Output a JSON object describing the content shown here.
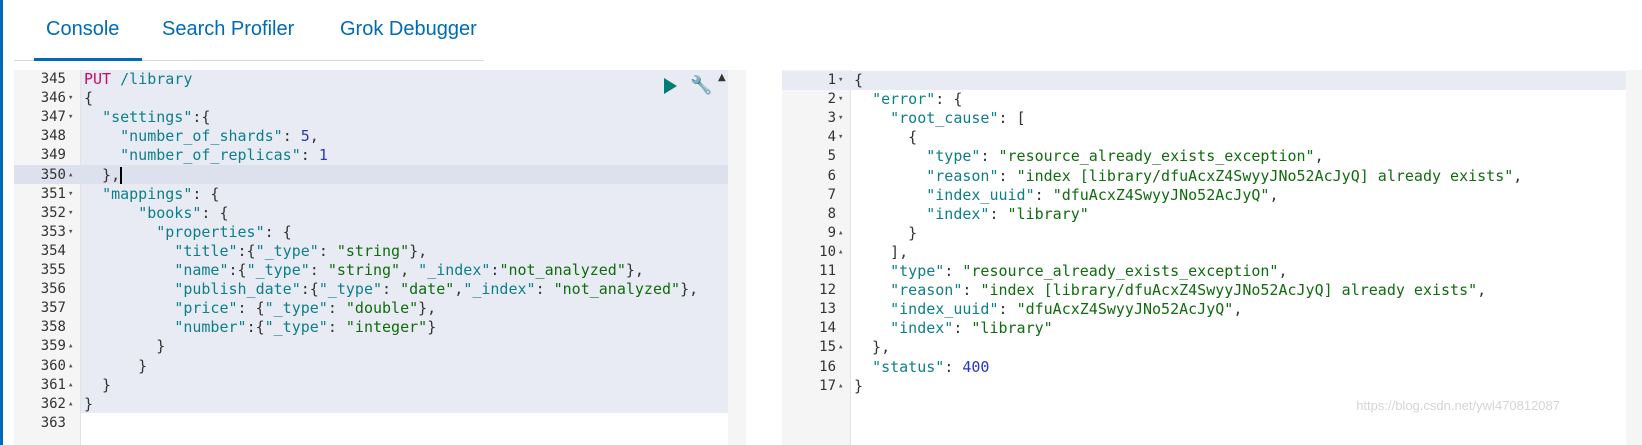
{
  "tabs": [
    "Console",
    "Search Profiler",
    "Grok Debugger"
  ],
  "request": {
    "lines": [
      {
        "n": "345",
        "f": "",
        "t": [
          [
            "m",
            "PUT"
          ],
          [
            "p",
            " "
          ],
          [
            "u",
            "/library"
          ]
        ]
      },
      {
        "n": "346",
        "f": "▾",
        "t": [
          [
            "p",
            "{"
          ]
        ]
      },
      {
        "n": "347",
        "f": "▾",
        "t": [
          [
            "p",
            "  "
          ],
          [
            "k",
            "\"settings\""
          ],
          [
            "p",
            ":{"
          ]
        ]
      },
      {
        "n": "348",
        "f": "",
        "t": [
          [
            "p",
            "    "
          ],
          [
            "k",
            "\"number_of_shards\""
          ],
          [
            "p",
            ": "
          ],
          [
            "n",
            "5"
          ],
          [
            "p",
            ","
          ]
        ]
      },
      {
        "n": "349",
        "f": "",
        "t": [
          [
            "p",
            "    "
          ],
          [
            "k",
            "\"number_of_replicas\""
          ],
          [
            "p",
            ": "
          ],
          [
            "n",
            "1"
          ]
        ]
      },
      {
        "n": "350",
        "f": "▴",
        "t": [
          [
            "p",
            "  },"
          ]
        ],
        "cursor": true
      },
      {
        "n": "351",
        "f": "▾",
        "t": [
          [
            "p",
            "  "
          ],
          [
            "k",
            "\"mappings\""
          ],
          [
            "p",
            ": {"
          ]
        ]
      },
      {
        "n": "352",
        "f": "▾",
        "t": [
          [
            "p",
            "      "
          ],
          [
            "k",
            "\"books\""
          ],
          [
            "p",
            ": {"
          ]
        ]
      },
      {
        "n": "353",
        "f": "▾",
        "t": [
          [
            "p",
            "        "
          ],
          [
            "k",
            "\"properties\""
          ],
          [
            "p",
            ": {"
          ]
        ]
      },
      {
        "n": "354",
        "f": "",
        "t": [
          [
            "p",
            "          "
          ],
          [
            "k",
            "\"title\""
          ],
          [
            "p",
            ":{"
          ],
          [
            "k",
            "\"_type\""
          ],
          [
            "p",
            ": "
          ],
          [
            "s",
            "\"string\""
          ],
          [
            "p",
            "},"
          ]
        ]
      },
      {
        "n": "355",
        "f": "",
        "t": [
          [
            "p",
            "          "
          ],
          [
            "k",
            "\"name\""
          ],
          [
            "p",
            ":{"
          ],
          [
            "k",
            "\"_type\""
          ],
          [
            "p",
            ": "
          ],
          [
            "s",
            "\"string\""
          ],
          [
            "p",
            ", "
          ],
          [
            "k",
            "\"_index\""
          ],
          [
            "p",
            ":"
          ],
          [
            "s",
            "\"not_analyzed\""
          ],
          [
            "p",
            "},"
          ]
        ]
      },
      {
        "n": "356",
        "f": "",
        "t": [
          [
            "p",
            "          "
          ],
          [
            "k",
            "\"publish_date\""
          ],
          [
            "p",
            ":{"
          ],
          [
            "k",
            "\"_type\""
          ],
          [
            "p",
            ": "
          ],
          [
            "s",
            "\"date\""
          ],
          [
            "p",
            ","
          ],
          [
            "k",
            "\"_index\""
          ],
          [
            "p",
            ": "
          ],
          [
            "s",
            "\"not_analyzed\""
          ],
          [
            "p",
            "},"
          ]
        ]
      },
      {
        "n": "357",
        "f": "",
        "t": [
          [
            "p",
            "          "
          ],
          [
            "k",
            "\"price\""
          ],
          [
            "p",
            ": {"
          ],
          [
            "k",
            "\"_type\""
          ],
          [
            "p",
            ": "
          ],
          [
            "s",
            "\"double\""
          ],
          [
            "p",
            "},"
          ]
        ]
      },
      {
        "n": "358",
        "f": "",
        "t": [
          [
            "p",
            "          "
          ],
          [
            "k",
            "\"number\""
          ],
          [
            "p",
            ":{"
          ],
          [
            "k",
            "\"_type\""
          ],
          [
            "p",
            ": "
          ],
          [
            "s",
            "\"integer\""
          ],
          [
            "p",
            "}"
          ]
        ]
      },
      {
        "n": "359",
        "f": "▴",
        "t": [
          [
            "p",
            "        }"
          ]
        ]
      },
      {
        "n": "360",
        "f": "▴",
        "t": [
          [
            "p",
            "      }"
          ]
        ]
      },
      {
        "n": "361",
        "f": "▴",
        "t": [
          [
            "p",
            "  }"
          ]
        ]
      },
      {
        "n": "362",
        "f": "▴",
        "t": [
          [
            "p",
            "}"
          ]
        ]
      },
      {
        "n": "363",
        "f": "",
        "t": []
      }
    ]
  },
  "response": {
    "lines": [
      {
        "n": "1",
        "f": "▾",
        "t": [
          [
            "p",
            "{"
          ]
        ]
      },
      {
        "n": "2",
        "f": "▾",
        "t": [
          [
            "p",
            "  "
          ],
          [
            "k",
            "\"error\""
          ],
          [
            "p",
            ": {"
          ]
        ]
      },
      {
        "n": "3",
        "f": "▾",
        "t": [
          [
            "p",
            "    "
          ],
          [
            "k",
            "\"root_cause\""
          ],
          [
            "p",
            ": ["
          ]
        ]
      },
      {
        "n": "4",
        "f": "▾",
        "t": [
          [
            "p",
            "      {"
          ]
        ]
      },
      {
        "n": "5",
        "f": "",
        "t": [
          [
            "p",
            "        "
          ],
          [
            "k",
            "\"type\""
          ],
          [
            "p",
            ": "
          ],
          [
            "s",
            "\"resource_already_exists_exception\""
          ],
          [
            "p",
            ","
          ]
        ]
      },
      {
        "n": "6",
        "f": "",
        "t": [
          [
            "p",
            "        "
          ],
          [
            "k",
            "\"reason\""
          ],
          [
            "p",
            ": "
          ],
          [
            "s",
            "\"index [library/dfuAcxZ4SwyyJNo52AcJyQ] already exists\""
          ],
          [
            "p",
            ","
          ]
        ]
      },
      {
        "n": "7",
        "f": "",
        "t": [
          [
            "p",
            "        "
          ],
          [
            "k",
            "\"index_uuid\""
          ],
          [
            "p",
            ": "
          ],
          [
            "s",
            "\"dfuAcxZ4SwyyJNo52AcJyQ\""
          ],
          [
            "p",
            ","
          ]
        ]
      },
      {
        "n": "8",
        "f": "",
        "t": [
          [
            "p",
            "        "
          ],
          [
            "k",
            "\"index\""
          ],
          [
            "p",
            ": "
          ],
          [
            "s",
            "\"library\""
          ]
        ]
      },
      {
        "n": "9",
        "f": "▴",
        "t": [
          [
            "p",
            "      }"
          ]
        ]
      },
      {
        "n": "10",
        "f": "▴",
        "t": [
          [
            "p",
            "    ],"
          ]
        ]
      },
      {
        "n": "11",
        "f": "",
        "t": [
          [
            "p",
            "    "
          ],
          [
            "k",
            "\"type\""
          ],
          [
            "p",
            ": "
          ],
          [
            "s",
            "\"resource_already_exists_exception\""
          ],
          [
            "p",
            ","
          ]
        ]
      },
      {
        "n": "12",
        "f": "",
        "t": [
          [
            "p",
            "    "
          ],
          [
            "k",
            "\"reason\""
          ],
          [
            "p",
            ": "
          ],
          [
            "s",
            "\"index [library/dfuAcxZ4SwyyJNo52AcJyQ] already exists\""
          ],
          [
            "p",
            ","
          ]
        ]
      },
      {
        "n": "13",
        "f": "",
        "t": [
          [
            "p",
            "    "
          ],
          [
            "k",
            "\"index_uuid\""
          ],
          [
            "p",
            ": "
          ],
          [
            "s",
            "\"dfuAcxZ4SwyyJNo52AcJyQ\""
          ],
          [
            "p",
            ","
          ]
        ]
      },
      {
        "n": "14",
        "f": "",
        "t": [
          [
            "p",
            "    "
          ],
          [
            "k",
            "\"index\""
          ],
          [
            "p",
            ": "
          ],
          [
            "s",
            "\"library\""
          ]
        ]
      },
      {
        "n": "15",
        "f": "▴",
        "t": [
          [
            "p",
            "  },"
          ]
        ]
      },
      {
        "n": "16",
        "f": "",
        "t": [
          [
            "p",
            "  "
          ],
          [
            "k",
            "\"status\""
          ],
          [
            "p",
            ": "
          ],
          [
            "n",
            "400"
          ]
        ]
      },
      {
        "n": "17",
        "f": "▴",
        "t": [
          [
            "p",
            "}"
          ]
        ]
      }
    ]
  },
  "icons": {
    "run": "play-icon",
    "settings": "wrench-icon"
  },
  "watermark": "https://blog.csdn.net/ywl470812087"
}
